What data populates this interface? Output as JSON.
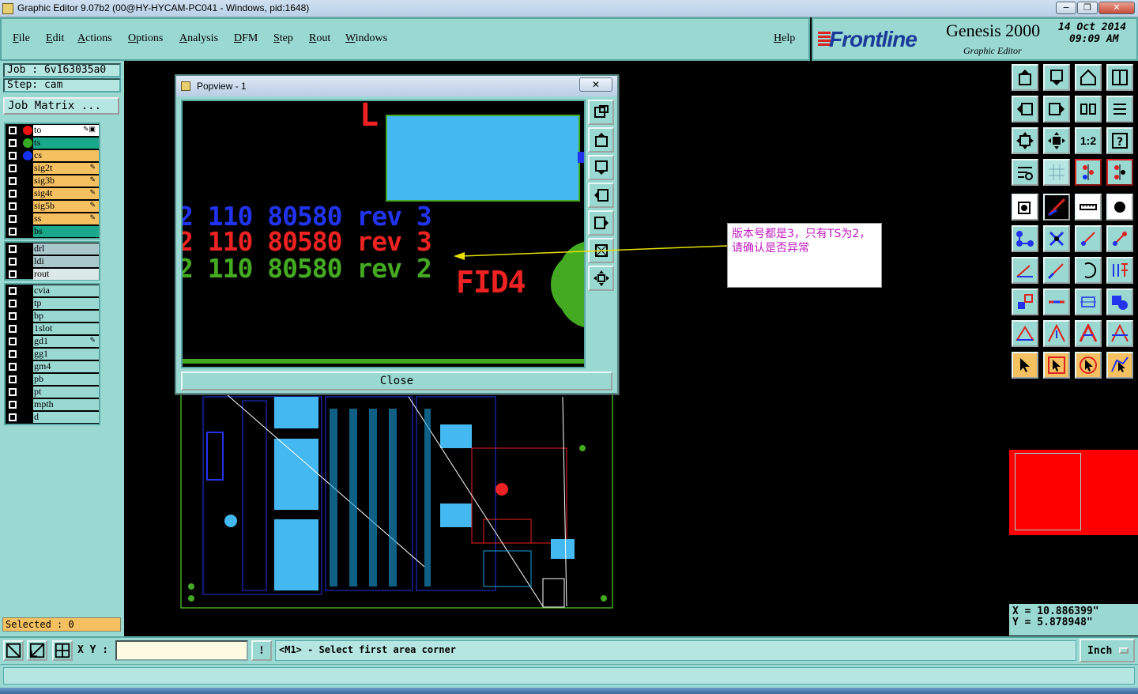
{
  "window": {
    "title": "Graphic Editor 9.07b2 (00@HY-HYCAM-PC041 - Windows, pid:1648)",
    "minimize": "−",
    "restore": "❐",
    "close": "✕"
  },
  "menu": {
    "items": [
      "File",
      "Edit",
      "Actions",
      "Options",
      "Analysis",
      "DFM",
      "Step",
      "Rout",
      "Windows"
    ],
    "help": "Help"
  },
  "logo": {
    "brand": "Frontline",
    "product": "Genesis 2000",
    "subtitle": "Graphic Editor",
    "date": "14 Oct 2014",
    "time": "09:09 AM"
  },
  "job": {
    "job_label": "Job  :  6v163035a0",
    "step_label": "Step: cam",
    "matrix_button": "Job Matrix ..."
  },
  "layers_group1": [
    {
      "name": "to",
      "bg": "#ffffff",
      "dot": "#ee1111",
      "pen": "✎▣"
    },
    {
      "name": "ts",
      "bg": "#1aa88a",
      "dot": "#33aa22",
      "pen": ""
    },
    {
      "name": "cs",
      "bg": "#f4c060",
      "dot": "#1133ee",
      "pen": ""
    },
    {
      "name": "sig2t",
      "bg": "#f4c060",
      "dot": "",
      "pen": "✎"
    },
    {
      "name": "sig3b",
      "bg": "#f4c060",
      "dot": "",
      "pen": "✎"
    },
    {
      "name": "sig4t",
      "bg": "#f4c060",
      "dot": "",
      "pen": "✎"
    },
    {
      "name": "sig5b",
      "bg": "#f4c060",
      "dot": "",
      "pen": "✎"
    },
    {
      "name": "ss",
      "bg": "#f4c060",
      "dot": "",
      "pen": "✎"
    },
    {
      "name": "bs",
      "bg": "#1aa88a",
      "dot": "",
      "pen": ""
    }
  ],
  "layers_group2": [
    {
      "name": "drl",
      "bg": "#aac8cc",
      "dot": "",
      "pen": ""
    },
    {
      "name": "ldi",
      "bg": "#aac8cc",
      "dot": "",
      "pen": ""
    },
    {
      "name": "rout",
      "bg": "#dde8e8",
      "dot": "",
      "pen": ""
    }
  ],
  "layers_group3": [
    {
      "name": "cvia",
      "bg": "#9ad8d2",
      "dot": "",
      "pen": ""
    },
    {
      "name": "tp",
      "bg": "#9ad8d2",
      "dot": "",
      "pen": ""
    },
    {
      "name": "bp",
      "bg": "#9ad8d2",
      "dot": "",
      "pen": ""
    },
    {
      "name": "1slot",
      "bg": "#9ad8d2",
      "dot": "",
      "pen": ""
    },
    {
      "name": "gd1",
      "bg": "#9ad8d2",
      "dot": "",
      "pen": "✎"
    },
    {
      "name": "gg1",
      "bg": "#9ad8d2",
      "dot": "",
      "pen": ""
    },
    {
      "name": "gm4",
      "bg": "#9ad8d2",
      "dot": "",
      "pen": ""
    },
    {
      "name": "pb",
      "bg": "#9ad8d2",
      "dot": "",
      "pen": ""
    },
    {
      "name": "pt",
      "bg": "#9ad8d2",
      "dot": "",
      "pen": ""
    },
    {
      "name": "mpth",
      "bg": "#9ad8d2",
      "dot": "",
      "pen": ""
    },
    {
      "name": "d",
      "bg": "#9ad8d2",
      "dot": "",
      "pen": ""
    }
  ],
  "selected": "Selected : 0",
  "popview": {
    "title": "Popview - 1",
    "close_x": "✕",
    "line1": "2 110 80580 rev 3",
    "line2": "2 110 80580 rev 3",
    "line3": "2 110 80580 rev 2",
    "fid": "FID4",
    "l_mark": "L",
    "close_button": "Close"
  },
  "callout": {
    "text": "版本号都是3，只有TS为2，请确认是否异常"
  },
  "coords": {
    "x": "X  =  10.886399\"",
    "y": "Y  =  5.878948\""
  },
  "bottom": {
    "xy_label": "X Y :",
    "xy_value": "",
    "excl": "!",
    "prompt": "<M1> - Select first area corner",
    "units": "Inch"
  },
  "colors": {
    "panel": "#9ad8d2",
    "accent_blue": "#2233ee",
    "accent_red": "#ee2222",
    "accent_green": "#44aa22",
    "callout_text": "#c018c0"
  }
}
